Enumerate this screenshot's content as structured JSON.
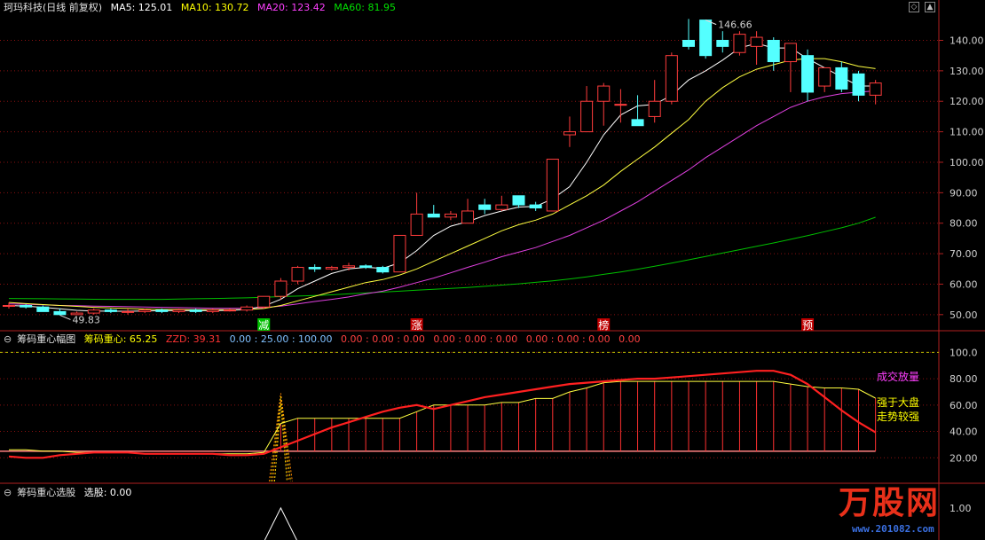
{
  "header": {
    "stock_name": "珂玛科技(日线 前复权)",
    "ma": [
      {
        "label": "MA5: 125.01",
        "color": "#ffffff"
      },
      {
        "label": "MA10: 130.72",
        "color": "#ffff00"
      },
      {
        "label": "MA20: 123.42",
        "color": "#ff40ff"
      },
      {
        "label": "MA60: 81.95",
        "color": "#00e000"
      }
    ]
  },
  "panel2_header": {
    "title": "筹码重心幅图",
    "items": [
      {
        "label": "筹码重心: 65.25",
        "color": "#ffff00"
      },
      {
        "label": "ZZD: 39.31",
        "color": "#ff3333"
      },
      {
        "label": "0.00 : 25.00 : 100.00",
        "color": "#80c0ff"
      },
      {
        "label": "0.00 : 0.00 : 0.00",
        "color": "#ff4040"
      },
      {
        "label": "0.00 : 0.00 : 0.00",
        "color": "#ff4040"
      },
      {
        "label": "0.00 : 0.00 : 0.00",
        "color": "#ff4040"
      },
      {
        "label": "0.00",
        "color": "#ff4040"
      }
    ]
  },
  "panel3_header": {
    "title": "筹码重心选股",
    "items": [
      {
        "label": "选股: 0.00",
        "color": "#ffffff"
      }
    ]
  },
  "panel2_annotations": [
    {
      "text": "成交放量",
      "color": "#ff40ff"
    },
    {
      "text": "强于大盘",
      "color": "#ffff00"
    },
    {
      "text": "走势较强",
      "color": "#ffff00"
    }
  ],
  "brand": {
    "name": "万股网",
    "url": "www.201082.com"
  },
  "chart_data": [
    {
      "type": "candlestick",
      "name": "main",
      "y_ticks": [
        "140.00",
        "130.00",
        "120.00",
        "110.00",
        "100.00",
        "90.00",
        "80.00",
        "70.00",
        "60.00",
        "50.00"
      ],
      "y_tick_values": [
        140,
        130,
        120,
        110,
        100,
        90,
        80,
        70,
        60,
        50
      ],
      "ylim": [
        45,
        148
      ],
      "annotations": [
        {
          "text": "146.66",
          "bar": 41,
          "value": 146.66
        },
        {
          "text": "49.83",
          "bar": 3,
          "value": 49.83
        }
      ],
      "markers": [
        {
          "text": "减",
          "bar": 15,
          "color": "#00c000"
        },
        {
          "text": "涨",
          "bar": 24,
          "color": "#c00000"
        },
        {
          "text": "榜",
          "bar": 35,
          "color": "#c00000"
        },
        {
          "text": "预",
          "bar": 47,
          "color": "#c00000"
        }
      ],
      "candles": [
        [
          53,
          54,
          52,
          53
        ],
        [
          53,
          53.5,
          52,
          52.5
        ],
        [
          52.5,
          53,
          51,
          51
        ],
        [
          51,
          52,
          50,
          50
        ],
        [
          50,
          51,
          49.83,
          50.5
        ],
        [
          50.5,
          52,
          50,
          51.5
        ],
        [
          51.5,
          52,
          50.5,
          51
        ],
        [
          51,
          52,
          50,
          51
        ],
        [
          51,
          52,
          50.5,
          51.5
        ],
        [
          51.5,
          52,
          50.5,
          51
        ],
        [
          51,
          52,
          50.5,
          51.5
        ],
        [
          51.5,
          52,
          50.5,
          51
        ],
        [
          51,
          52,
          50.5,
          51.5
        ],
        [
          51.5,
          52,
          51,
          51.5
        ],
        [
          51.5,
          53,
          51,
          52.5
        ],
        [
          52.5,
          56,
          52,
          56
        ],
        [
          56,
          62,
          55,
          61
        ],
        [
          61,
          66,
          60,
          65.5
        ],
        [
          65.5,
          66.5,
          64,
          65
        ],
        [
          65,
          66,
          64.5,
          65.5
        ],
        [
          65.5,
          67,
          64.5,
          66
        ],
        [
          66,
          66.5,
          65,
          65.5
        ],
        [
          65.5,
          66,
          63.5,
          64
        ],
        [
          64,
          76,
          64,
          76
        ],
        [
          76,
          90,
          76,
          83
        ],
        [
          83,
          86,
          82,
          82
        ],
        [
          82,
          84,
          81,
          83
        ],
        [
          80,
          88,
          80,
          84
        ],
        [
          86,
          88,
          83,
          84.5
        ],
        [
          84.5,
          89,
          84,
          86
        ],
        [
          89,
          89,
          85,
          86
        ],
        [
          86,
          87,
          84,
          85
        ],
        [
          84,
          101,
          84,
          101
        ],
        [
          109,
          115,
          105,
          110
        ],
        [
          110,
          125,
          110,
          120
        ],
        [
          120,
          126,
          112,
          125
        ],
        [
          119,
          124,
          113,
          119
        ],
        [
          114,
          122,
          112,
          112
        ],
        [
          115,
          127,
          113,
          120
        ],
        [
          120,
          136,
          119,
          135
        ],
        [
          140,
          147,
          137,
          138
        ],
        [
          146.66,
          146.66,
          134,
          135
        ],
        [
          140,
          143,
          136,
          138
        ],
        [
          136,
          143,
          135,
          142
        ],
        [
          138,
          143,
          132,
          141
        ],
        [
          140,
          141,
          130,
          133
        ],
        [
          133,
          138,
          123,
          139
        ],
        [
          135,
          137,
          120,
          123
        ],
        [
          125,
          131,
          123,
          131
        ],
        [
          131,
          133,
          123,
          124
        ],
        [
          129,
          130,
          120,
          122
        ],
        [
          122,
          127,
          119,
          126
        ]
      ],
      "ma5": [
        53,
        52.8,
        52.4,
        51.9,
        51.4,
        51.2,
        51.1,
        51.1,
        51.2,
        51.3,
        51.3,
        51.3,
        51.3,
        51.4,
        51.7,
        52.8,
        55,
        58.5,
        61,
        63.5,
        65,
        65.5,
        65.2,
        67,
        71,
        76,
        79,
        80.5,
        82.5,
        84,
        85.3,
        85.5,
        88,
        92,
        100,
        109,
        115.5,
        118.5,
        119,
        122,
        127,
        130,
        133.5,
        137.5,
        139,
        137.5,
        137.5,
        134,
        131,
        128,
        125,
        125.01
      ],
      "ma10": [
        54,
        53.6,
        53.3,
        53,
        52.7,
        52.4,
        52.2,
        52,
        51.8,
        51.7,
        51.7,
        51.6,
        51.6,
        51.6,
        51.6,
        52,
        53,
        54.5,
        56,
        57.5,
        59,
        60.5,
        61.5,
        63,
        65,
        67.5,
        70,
        72.5,
        75,
        77.5,
        79.5,
        81,
        83,
        86,
        89,
        92.5,
        97,
        101,
        105,
        109.5,
        114,
        120,
        124.5,
        128,
        130.5,
        132,
        133.5,
        134,
        134,
        133,
        131.5,
        130.72
      ],
      "ma20": [
        53.5,
        53.4,
        53.2,
        53,
        52.9,
        52.8,
        52.7,
        52.6,
        52.5,
        52.4,
        52.3,
        52.2,
        52.1,
        52.1,
        52.1,
        52.3,
        52.8,
        53.5,
        54.3,
        55,
        55.8,
        56.8,
        57.7,
        59,
        60.5,
        62,
        63.7,
        65.5,
        67.2,
        69,
        70.5,
        72,
        74,
        76,
        78.5,
        81,
        84,
        87,
        90.5,
        94,
        97.5,
        101.5,
        105,
        108.5,
        112,
        115,
        118,
        120,
        121.5,
        122.5,
        123,
        123.42
      ],
      "ma60": [
        55.3,
        55.25,
        55.2,
        55.15,
        55.1,
        55.05,
        55,
        55,
        55,
        55,
        55.1,
        55.2,
        55.3,
        55.4,
        55.5,
        55.7,
        55.9,
        56.1,
        56.3,
        56.5,
        56.8,
        57.1,
        57.4,
        57.7,
        58,
        58.3,
        58.6,
        58.9,
        59.3,
        59.7,
        60.1,
        60.6,
        61.1,
        61.7,
        62.4,
        63.2,
        64,
        64.9,
        65.9,
        66.9,
        68,
        69.1,
        70.2,
        71.3,
        72.4,
        73.5,
        74.7,
        75.9,
        77.2,
        78.5,
        80,
        81.95
      ]
    },
    {
      "type": "line",
      "name": "筹码重心幅图",
      "y_ticks": [
        "100.0",
        "80.00",
        "60.00",
        "40.00",
        "20.00"
      ],
      "y_tick_values": [
        100,
        80,
        60,
        40,
        20
      ],
      "ylim": [
        2,
        105
      ],
      "reference_lines": [
        {
          "value": 100,
          "style": "dashed",
          "color": "#bbbb00"
        },
        {
          "value": 25,
          "color": "#ff8080"
        }
      ],
      "series": [
        {
          "name": "筹码重心",
          "color": "#ffff00",
          "values": [
            26,
            26,
            25,
            25,
            24,
            24,
            24,
            24,
            23,
            23,
            23,
            23,
            23,
            23,
            23,
            24,
            46,
            50,
            50,
            50,
            50,
            50,
            50,
            50,
            55,
            60,
            60,
            60,
            60,
            62,
            62,
            65,
            65,
            70,
            73,
            77,
            78,
            78,
            78,
            78,
            78,
            78,
            78,
            78,
            78,
            78,
            76,
            74,
            73,
            73,
            72,
            65.25
          ]
        },
        {
          "name": "ZZD",
          "color": "#ff3333",
          "values": [
            21,
            20,
            20,
            22,
            23,
            24,
            24,
            24,
            23,
            23,
            23,
            23,
            23,
            22,
            22,
            23,
            28,
            33,
            38,
            43,
            47,
            51,
            55,
            58,
            60,
            57,
            60,
            63,
            66,
            68,
            70,
            72,
            74,
            76,
            77,
            78,
            79,
            80,
            80,
            81,
            82,
            83,
            84,
            85,
            86,
            86,
            83,
            76,
            66,
            56,
            47,
            39.31
          ]
        }
      ]
    },
    {
      "type": "line",
      "name": "筹码重心选股",
      "y_ticks": [
        "1.00"
      ],
      "y_tick_values": [
        1
      ],
      "ylim": [
        0,
        1.3
      ],
      "series": [
        {
          "name": "选股",
          "color": "#ffffff",
          "values": [
            0,
            0,
            0,
            0,
            0,
            0,
            0,
            0,
            0,
            0,
            0,
            0,
            0,
            0,
            0,
            0,
            1,
            0,
            0,
            0,
            0,
            0,
            0,
            0,
            0,
            0,
            0,
            0,
            0,
            0,
            0,
            0,
            0,
            0,
            0,
            0,
            0,
            0,
            0,
            0,
            0,
            0,
            0,
            0,
            0,
            0,
            0,
            0,
            0,
            0,
            0,
            0
          ]
        }
      ]
    }
  ]
}
